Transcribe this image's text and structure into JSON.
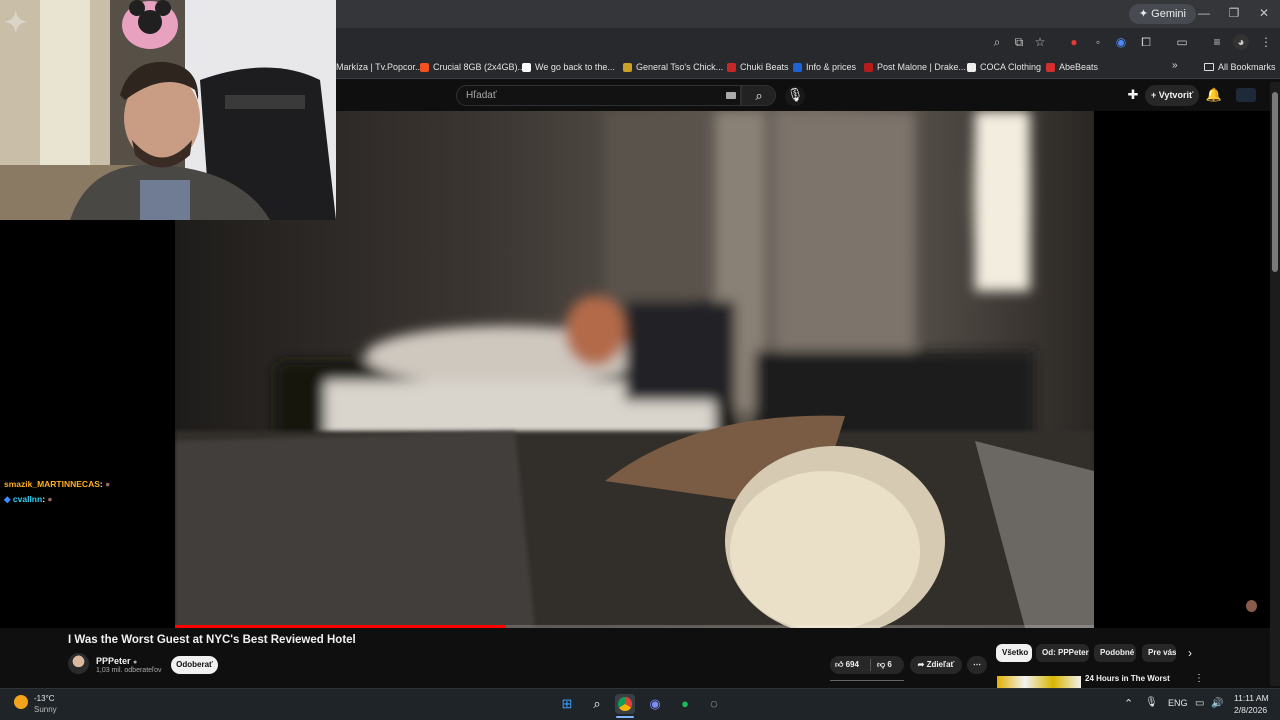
{
  "browser": {
    "gemini_label": "Gemini",
    "bookmarks": [
      {
        "label": "Markíza | Tv.Popcor...",
        "color": "#e53935"
      },
      {
        "label": "Crucial 8GB (2x4GB)...",
        "color": "#f4511e"
      },
      {
        "label": "We go back to the...",
        "color": "#ffffff"
      },
      {
        "label": "General Tso's Chick...",
        "color": "#c9a227"
      },
      {
        "label": "Chuki Beats",
        "color": "#c62828"
      },
      {
        "label": "Info & prices",
        "color": "#1e63d6"
      },
      {
        "label": "Post Malone | Drake...",
        "color": "#b71c1c"
      },
      {
        "label": "COCA Clothing",
        "color": "#eeeeee"
      },
      {
        "label": "AbeBeats",
        "color": "#d32f2f"
      }
    ],
    "all_bookmarks_label": "All Bookmarks"
  },
  "youtube": {
    "search_placeholder": "Hľadať",
    "create_label": "Vytvoriť",
    "video": {
      "title": "I Was the Worst Guest at NYC's Best Reviewed Hotel",
      "channel": "PPPeter",
      "subscribers": "1,03 mil. odberateľov",
      "subscribe_label": "Odoberať",
      "likes": "694",
      "dislikes": "6",
      "share_label": "Zdieľať",
      "progress": 0.36
    },
    "chips": [
      "Všetko",
      "Od: PPPeter",
      "Podobné",
      "Pre vás"
    ],
    "recommended_title": "24 Hours in The Worst"
  },
  "stream_chat": [
    {
      "user": "smazik_MARTINNECAS",
      "color": "#ffb020",
      "suffix": ":"
    },
    {
      "user": "cvallnn",
      "color": "#2fd0f0",
      "suffix": ":"
    }
  ],
  "taskbar": {
    "weather_temp": "-13°C",
    "weather_desc": "Sunny",
    "language": "ENG",
    "time": "11:11 AM",
    "date": "2/8/2026"
  }
}
